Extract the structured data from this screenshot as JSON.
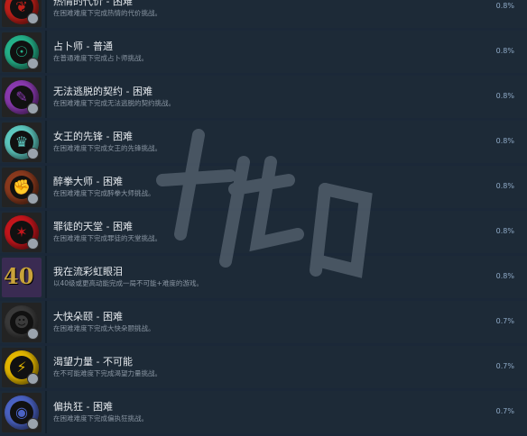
{
  "achievements": [
    {
      "title": "热情的代价 - 困难",
      "desc": "在困难难度下完成热情的代价挑战。",
      "pct": "0.8%",
      "icon": "heart-icon",
      "color": "#c0201a",
      "glyph": "❦"
    },
    {
      "title": "占卜师 - 普通",
      "desc": "在普通难度下完成占卜师挑战。",
      "pct": "0.8%",
      "icon": "fortune-teller-icon",
      "color": "#25b28a",
      "glyph": "☉"
    },
    {
      "title": "无法逃脱的契约 - 困难",
      "desc": "在困难难度下完成无法逃脱的契约挑战。",
      "pct": "0.8%",
      "icon": "contract-icon",
      "color": "#8a3ab0",
      "glyph": "✎"
    },
    {
      "title": "女王的先锋 - 困难",
      "desc": "在困难难度下完成女王的先锋挑战。",
      "pct": "0.8%",
      "icon": "queen-vanguard-icon",
      "color": "#5ec9c0",
      "glyph": "♛"
    },
    {
      "title": "醉拳大师 - 困难",
      "desc": "在困难难度下完成醉拳大师挑战。",
      "pct": "0.8%",
      "icon": "drunken-master-icon",
      "color": "#8a3a1e",
      "glyph": "✊"
    },
    {
      "title": "罪徒的天堂 - 困难",
      "desc": "在困难难度下完成罪徒的天堂挑战。",
      "pct": "0.8%",
      "icon": "sinners-paradise-icon",
      "color": "#c4161c",
      "glyph": "✶"
    },
    {
      "title": "我在流彩虹眼泪",
      "desc": "以40级或更高动能完成一局不可能+难度的游戏。",
      "pct": "0.8%",
      "icon": "level-40-icon",
      "color": "#c9a33a",
      "glyph": "40"
    },
    {
      "title": "大快朵颐 - 困难",
      "desc": "在困难难度下完成大快朵颐挑战。",
      "pct": "0.7%",
      "icon": "feast-icon",
      "color": "#3a3a3a",
      "glyph": "☻"
    },
    {
      "title": "渴望力量 - 不可能",
      "desc": "在不可能难度下完成渴望力量挑战。",
      "pct": "0.7%",
      "icon": "lightning-icon",
      "color": "#e5b800",
      "glyph": "⚡"
    },
    {
      "title": "偏执狂 - 困难",
      "desc": "在困难难度下完成偏执狂挑战。",
      "pct": "0.7%",
      "icon": "eye-icon",
      "color": "#4b63c4",
      "glyph": "◉"
    }
  ]
}
